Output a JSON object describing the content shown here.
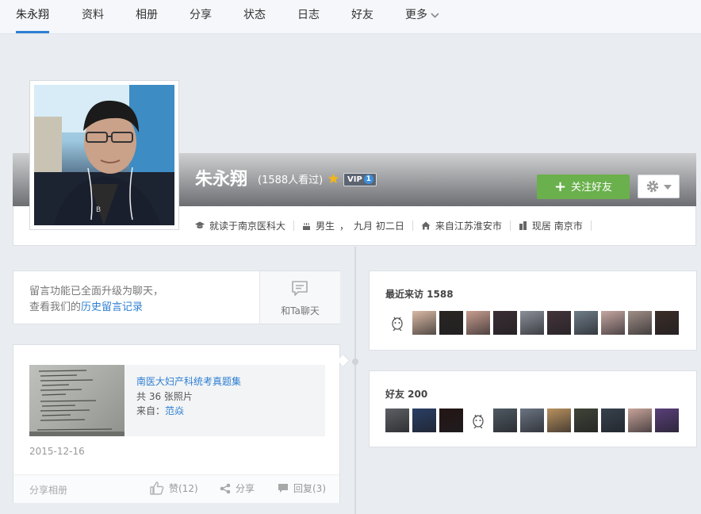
{
  "nav": {
    "tabs": [
      "朱永翔",
      "资料",
      "相册",
      "分享",
      "状态",
      "日志",
      "好友",
      "更多"
    ]
  },
  "profile": {
    "name": "朱永翔",
    "views": "(1588人看过)",
    "vip_label": "VIP",
    "vip_level": "1",
    "follow_label": "关注好友",
    "school": "就读于南京医科大",
    "gender": "男生",
    "birthday_sep": "，",
    "birthday": "九月 初二日",
    "hometown": "来自江苏淮安市",
    "residence": "现居 南京市"
  },
  "message": {
    "line1": "留言功能已全面升级为聊天，",
    "line2_prefix": "查看我们的",
    "line2_link": "历史留言记录",
    "chat_label": "和Ta聊天"
  },
  "post": {
    "album_title": "南医大妇产科统考真题集",
    "photo_count": "共 36 张照片",
    "from_label": "来自：",
    "from_user": "范焱",
    "date": "2015-12-16",
    "source": "分享相册",
    "like_label": "赞(12)",
    "share_label": "分享",
    "reply_label": "回复(3)"
  },
  "visitors": {
    "title": "最近来访 1588",
    "avatar_colors": [
      "#d9b9a3",
      "#2a2522",
      "#c89d8e",
      "#3b2e33",
      "#8a8f99",
      "#45353a",
      "#6f7c88",
      "#c5a6a0",
      "#a08e86",
      "#3b2c26"
    ]
  },
  "friends": {
    "title": "好友 200",
    "avatar_colors": [
      "#5d6064",
      "#2a3f66",
      "#241514",
      "#4f5a63",
      "#6a7482",
      "#b9915f",
      "#3f4436",
      "#36424e",
      "#c7a39a",
      "#5a3f7a"
    ]
  },
  "colors": {
    "accent": "#2d7fd3",
    "follow_green": "#6ab04c"
  }
}
